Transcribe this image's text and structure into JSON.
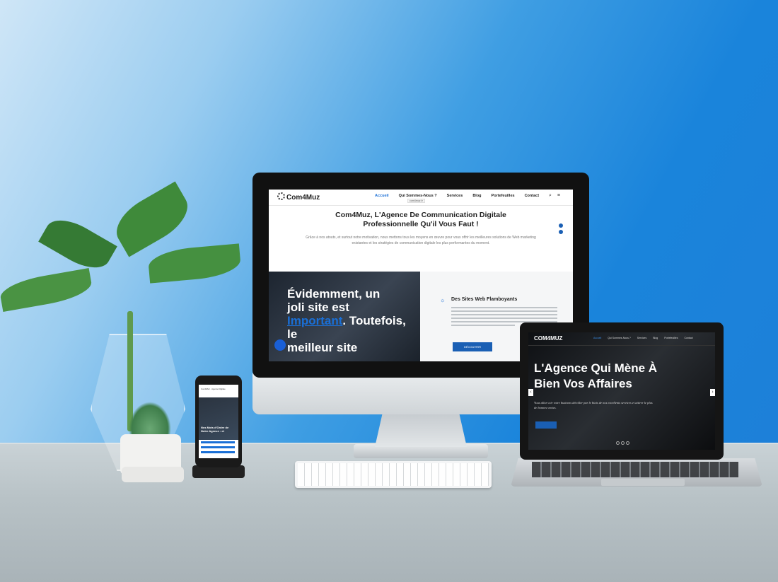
{
  "scene": {
    "background": "#1e7fd8",
    "description_tag": "devices-mockup"
  },
  "desktop_site": {
    "logo": "Com4Muz",
    "nav": [
      "Accueil",
      "Qui Sommes-Nous ?",
      "Services",
      "Blog",
      "Portefeuilles",
      "Contact"
    ],
    "url_tooltip": "com4muz.fr",
    "hero_title_line1": "Com4Muz, L'Agence De Communication Digitale",
    "hero_title_line2": "Professionnelle Qu'il Vous Faut !",
    "hero_text": "Grâce à nos atouts, et surtout notre motivation, nous mettons tous les moyens en œuvre pour vous offrir les meilleures solutions de Web marketing existantes et les stratégies de communication digitale les plus performantes du moment.",
    "panel_line1": "Évidemment, un",
    "panel_line2": "joli site est",
    "panel_highlight": "Important",
    "panel_line3": ". Toutefois, le",
    "panel_line4": "meilleur site",
    "feature_title": "Des Sites Web Flamboyants",
    "feature_button": "DÉCOUVRIR"
  },
  "laptop_site": {
    "logo": "COM4MUZ",
    "nav": [
      "Accueil",
      "Qui Sommes-Nous ?",
      "Services",
      "Blog",
      "Portefeuilles",
      "Contact"
    ],
    "title_line1": "L'Agence Qui Mène À",
    "title_line2": "Bien Vos Affaires",
    "subtitle": "Vous allez voir votre business décoller par le biais de nos excellents services et attirer le plus de bonnes ventes.",
    "button": "LIRE PLUS"
  },
  "phone_site": {
    "header": "Com4Muz · Agence Digitale",
    "dark_text": "Nos Mots d'Ordre de Notre Agence : et"
  }
}
